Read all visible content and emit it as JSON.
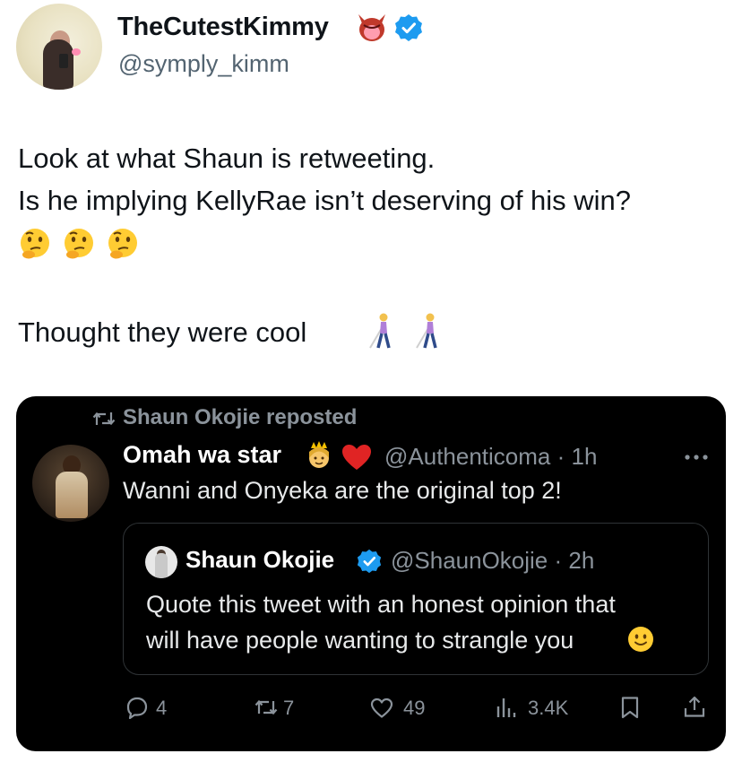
{
  "author": {
    "display_name": "TheCutestKimmy",
    "handle": "@symply_kimm",
    "emoji": "devil-tongue-emoji",
    "verified": true
  },
  "tweet": {
    "line1": "Look at what Shaun is retweeting.",
    "line2": "Is he implying KellyRae isn’t deserving of his win?",
    "emojis_row": [
      "thinking-face",
      "thinking-face",
      "thinking-face"
    ],
    "line3": "Thought they were cool",
    "line3_emojis": [
      "person-with-white-cane",
      "person-with-white-cane"
    ]
  },
  "embedded": {
    "repost_label": "Shaun Okojie reposted",
    "author": {
      "display_name": "Omah wa star",
      "emojis": [
        "princess-emoji",
        "red-heart-emoji"
      ],
      "handle_time": "@Authenticoma · 1h"
    },
    "text": "Wanni and Onyeka are the original top 2!",
    "quote": {
      "display_name": "Shaun Okojie",
      "verified": true,
      "handle_time": "@ShaunOkojie · 2h",
      "line1": "Quote this tweet with an honest opinion that",
      "line2": "will have people wanting to strangle you",
      "emoji": "slightly-smiling-face"
    },
    "actions": {
      "replies": "4",
      "reposts": "7",
      "likes": "49",
      "views": "3.4K"
    }
  },
  "colors": {
    "verified_blue": "#1d9bf0",
    "card_background": "#000000",
    "muted_text": "#8b939b"
  }
}
